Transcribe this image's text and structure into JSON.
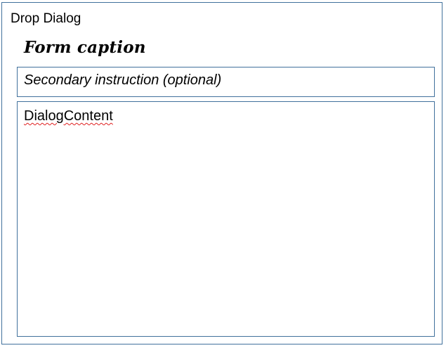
{
  "dialog": {
    "title": "Drop Dialog",
    "caption": "Form caption",
    "instruction": "Secondary instruction (optional)",
    "content": "DialogContent",
    "colors": {
      "border": "#41719c",
      "spellcheck_underline": "#e02020"
    }
  }
}
